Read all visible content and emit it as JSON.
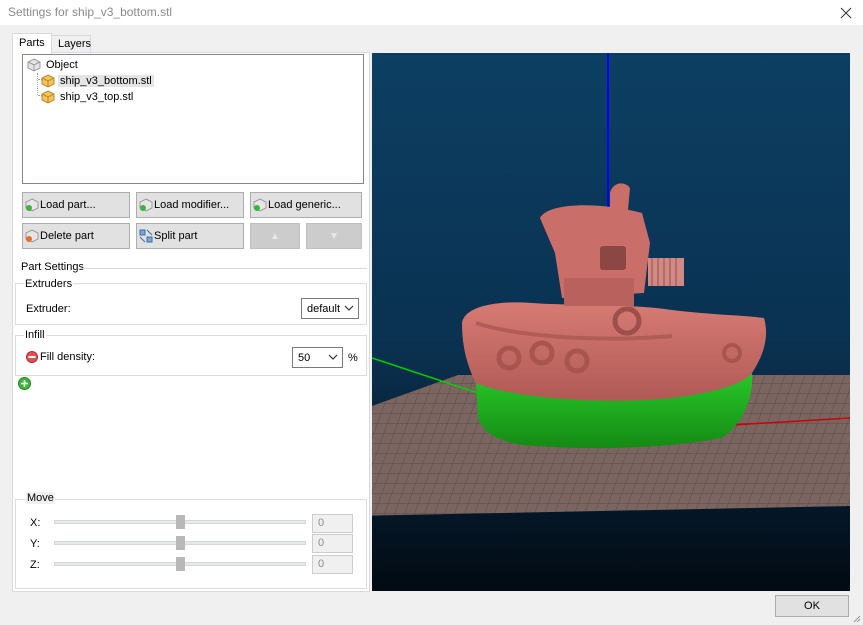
{
  "window": {
    "title": "Settings for ship_v3_bottom.stl",
    "close_icon": "close-icon"
  },
  "tabs": [
    {
      "label": "Parts",
      "active": true
    },
    {
      "label": "Layers",
      "active": false
    }
  ],
  "tree": {
    "root": {
      "label": "Object",
      "icon": "cube-icon"
    },
    "items": [
      {
        "label": "ship_v3_bottom.stl",
        "icon": "part-cube-icon",
        "selected": true
      },
      {
        "label": "ship_v3_top.stl",
        "icon": "part-cube-icon",
        "selected": false
      }
    ]
  },
  "buttons": {
    "load_part": "Load part...",
    "load_modifier": "Load modifier...",
    "load_generic": "Load generic...",
    "delete_part": "Delete part",
    "split_part": "Split part",
    "move_up": "▲",
    "move_down": "▼"
  },
  "part_settings": {
    "title": "Part Settings",
    "extruders": {
      "title": "Extruders",
      "extruder_label": "Extruder:",
      "extruder_value": "default"
    },
    "infill": {
      "title": "Infill",
      "fill_density_label": "Fill density:",
      "fill_density_value": "50",
      "fill_density_unit": "%"
    },
    "add_setting_icon": "plus-circle-icon"
  },
  "move": {
    "title": "Move",
    "x_label": "X:",
    "y_label": "Y:",
    "z_label": "Z:",
    "x_value": "0",
    "y_value": "0",
    "z_value": "0",
    "x_slider_fraction": 0.5,
    "y_slider_fraction": 0.5,
    "z_slider_fraction": 0.5
  },
  "footer": {
    "ok_label": "OK"
  },
  "colors": {
    "viewport_top": "#0c3f63",
    "viewport_bottom": "#020a12",
    "ship_top": "#c96e69",
    "ship_bottom": "#21b421",
    "axis_z": "#0000ff",
    "axis_y": "#00d000",
    "axis_x": "#d00000",
    "bed": "#7a6560"
  }
}
